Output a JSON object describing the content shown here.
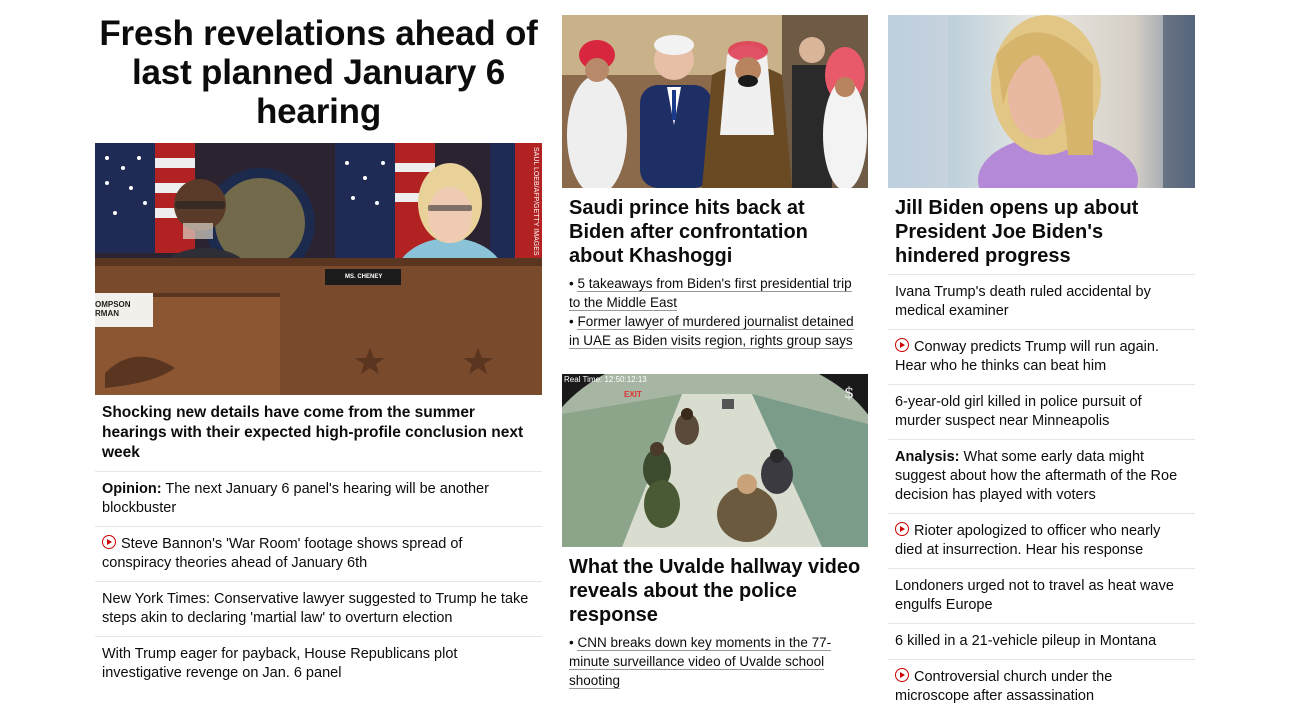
{
  "column1": {
    "headline": "Fresh revelations ahead of last planned January 6 hearing",
    "photo_credit": "SAUL LOEB/AFP/GETTY IMAGES",
    "photo_nameplate": "MS. CHENEY",
    "photo_podium_text": "OMPSON\nRMAN",
    "summary": "Shocking new details have come from the summer hearings with their expected high-profile conclusion next week",
    "links": [
      {
        "prefix": "Opinion:",
        "text": " The next January 6 panel's hearing will be another blockbuster",
        "video": false
      },
      {
        "prefix": "",
        "text": "Steve Bannon's 'War Room' footage shows spread of conspiracy theories ahead of January 6th",
        "video": true
      },
      {
        "prefix": "",
        "text": "New York Times: Conservative lawyer suggested to Trump he take steps akin to declaring 'martial law' to overturn election",
        "video": false
      },
      {
        "prefix": "",
        "text": "With Trump eager for payback, House Republicans plot investigative revenge on Jan. 6 panel",
        "video": false
      }
    ]
  },
  "column2": {
    "card1": {
      "headline": "Saudi prince hits back at Biden after confrontation about Khashoggi",
      "sub_links": [
        "5 takeaways from Biden's first presidential trip to the Middle East",
        "Former lawyer of murdered journalist detained in UAE as Biden visits region, rights group says"
      ]
    },
    "card2": {
      "video_timestamp": "Real Time: 12:50:12:13",
      "video_exit_sign": "EXIT",
      "headline": "What the Uvalde hallway video reveals about the police response",
      "sub_links": [
        "CNN breaks down key moments in the 77-minute surveillance video of Uvalde school shooting"
      ]
    }
  },
  "column3": {
    "headline": "Jill Biden opens up about President Joe Biden's hindered progress",
    "links": [
      {
        "prefix": "",
        "text": "Ivana Trump's death ruled accidental by medical examiner",
        "video": false
      },
      {
        "prefix": "",
        "text": "Conway predicts Trump will run again. Hear who he thinks can beat him",
        "video": true
      },
      {
        "prefix": "",
        "text": "6-year-old girl killed in police pursuit of murder suspect near Minneapolis",
        "video": false
      },
      {
        "prefix": "Analysis:",
        "text": " What some early data might suggest about how the aftermath of the Roe decision has played with voters",
        "video": false
      },
      {
        "prefix": "",
        "text": "Rioter apologized to officer who nearly died at insurrection. Hear his response",
        "video": true
      },
      {
        "prefix": "",
        "text": "Londoners urged not to travel as heat wave engulfs Europe",
        "video": false
      },
      {
        "prefix": "",
        "text": "6 killed in a 21-vehicle pileup in Montana",
        "video": false
      },
      {
        "prefix": "",
        "text": "Controversial church under the microscope after assassination",
        "video": true
      }
    ]
  },
  "colors": {
    "text": "#0c0c0c",
    "divider": "#e6e6e6",
    "video_icon": "#cc0000"
  }
}
